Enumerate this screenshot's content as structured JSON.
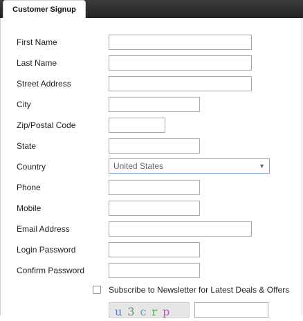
{
  "tab": {
    "title": "Customer Signup"
  },
  "form": {
    "first_name_label": "First Name",
    "last_name_label": "Last Name",
    "street_label": "Street Address",
    "city_label": "City",
    "zip_label": "Zip/Postal Code",
    "state_label": "State",
    "country_label": "Country",
    "country_value": "United States",
    "phone_label": "Phone",
    "mobile_label": "Mobile",
    "email_label": "Email Address",
    "password_label": "Login Password",
    "confirm_label": "Confirm Password",
    "newsletter_label": "Subscribe to Newsletter for Latest Deals & Offers",
    "newsletter_checked": false
  },
  "captcha": {
    "chars": [
      "u",
      "3",
      "c",
      "r",
      "p"
    ]
  }
}
